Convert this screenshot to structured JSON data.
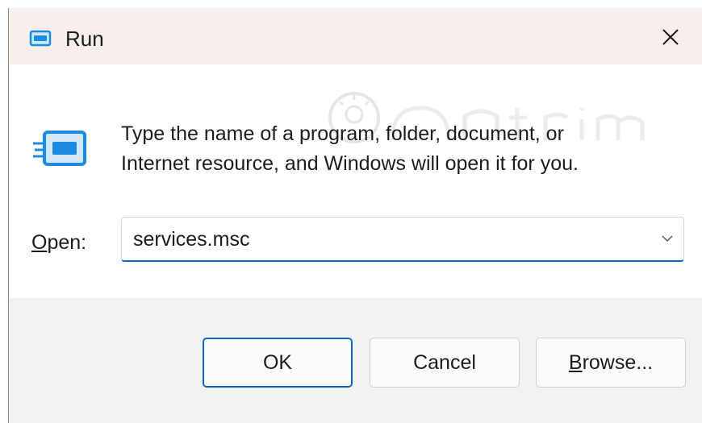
{
  "window": {
    "title": "Run",
    "close_glyph": "✕"
  },
  "prompt": {
    "line1": "Type the name of a program, folder, document, or",
    "line2": "Internet resource, and Windows will open it for you."
  },
  "open_field": {
    "label_mnemonic": "O",
    "label_rest": "pen:",
    "value": "services.msc"
  },
  "buttons": {
    "ok": "OK",
    "cancel": "Cancel",
    "browse_mnemonic": "B",
    "browse_rest": "rowse..."
  },
  "icons": {
    "title": "run-app-icon",
    "dialog": "run-app-icon-large",
    "close": "close-icon",
    "dropdown": "chevron-down-icon"
  },
  "colors": {
    "accent": "#0a64c8",
    "titlebar": "#f7efeb",
    "footer": "#f2f2f2",
    "icon_blue": "#1b8ae0"
  }
}
